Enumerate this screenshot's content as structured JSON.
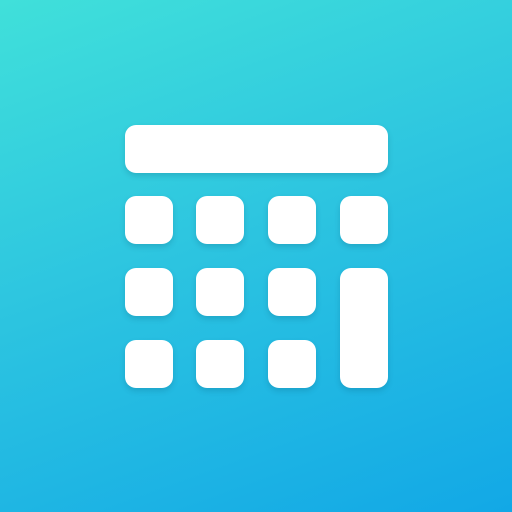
{
  "app_icon": {
    "icon": "calculator-icon",
    "colors": {
      "gradient_start": "#40e0da",
      "gradient_end": "#12a8e6",
      "glyph": "#ffffff"
    },
    "keypad": {
      "rows": 3,
      "columns": 4,
      "key_count": 11
    }
  }
}
